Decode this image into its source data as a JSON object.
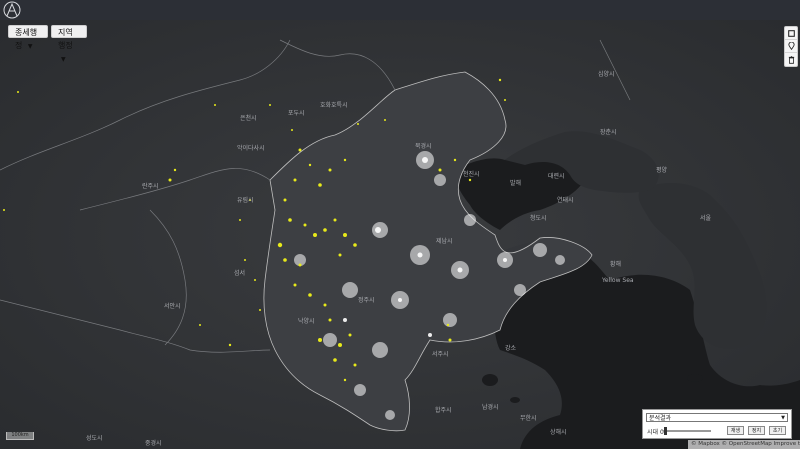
{
  "header": {
    "logo_icon": "compass-a-logo-icon"
  },
  "controls": {
    "layer_dropdown": "종세행정",
    "region_dropdown": "지역행정"
  },
  "map_controls": {
    "icons": [
      "fullscreen-icon",
      "location-pin-icon",
      "delete-icon"
    ]
  },
  "panel": {
    "select_value": "분석결과",
    "time_label": "시대 0",
    "buttons": [
      "재생",
      "정지",
      "초기"
    ]
  },
  "attribution": "© Mapbox © OpenStreetMap Improve this map",
  "scale": "100km",
  "map_labels": {
    "beijing": "북경시",
    "tianjin": "천진시",
    "shenyang": "심양시",
    "dalian": "대련시",
    "pyongyang": "평양",
    "seoul": "서울",
    "yellow_sea": "황해",
    "yellow_sea_en": "Yellow Sea",
    "bohai": "발해",
    "jinan": "제남시",
    "taiyuan": "태원시",
    "shijiazhuang": "석가장시",
    "zhengzhou": "정주시",
    "xian": "서안시",
    "nanjing": "남경시",
    "shanghai": "상해시",
    "chengdu": "성도시",
    "chongqing": "중경시",
    "hefei": "합주시",
    "wuhan": "무한시",
    "hohhot": "호화호특시",
    "baotou": "포두시",
    "yinchuan": "은천시",
    "lanzhou": "란주시",
    "changchun": "장춘시",
    "jiangsu": "강소",
    "hebei": "하북",
    "shanxi": "섬서",
    "anhui": "안휘",
    "ordos": "악이다사시",
    "yulin": "유림시",
    "datong": "대동시",
    "zhangjiakou": "장가구시",
    "qingdao": "청도시",
    "xuzhou": "서주시",
    "luoyang": "낙양시",
    "handan": "한단시",
    "tangshan": "당산시",
    "yantai": "연태시",
    "baoding": "보정시"
  },
  "colors": {
    "water": "#1b1c1e",
    "land": "#2e3033",
    "highlight_points": "#e8ea1a",
    "city_lights": "#ffffff",
    "topbar": "#2c2f36"
  }
}
